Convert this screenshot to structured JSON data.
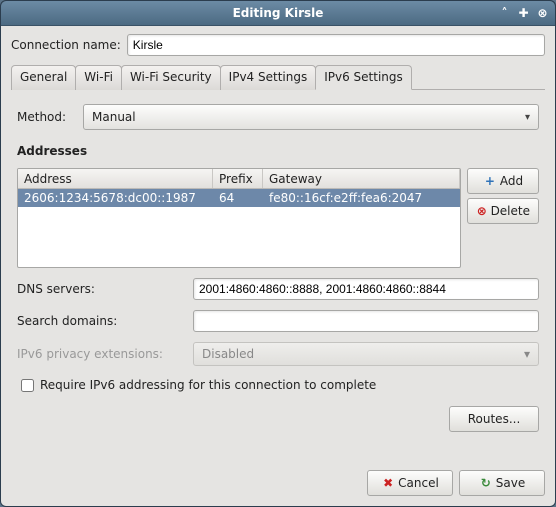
{
  "window": {
    "title": "Editing Kirsle"
  },
  "connection": {
    "label": "Connection name:",
    "value": "Kirsle"
  },
  "tabs": {
    "general": "General",
    "wifi": "Wi-Fi",
    "wifisec": "Wi-Fi Security",
    "ipv4": "IPv4 Settings",
    "ipv6": "IPv6 Settings",
    "active": "ipv6"
  },
  "method": {
    "label": "Method:",
    "value": "Manual"
  },
  "addresses": {
    "title": "Addresses",
    "columns": {
      "address": "Address",
      "prefix": "Prefix",
      "gateway": "Gateway"
    },
    "rows": [
      {
        "address": "2606:1234:5678:dc00::1987",
        "prefix": "64",
        "gateway": "fe80::16cf:e2ff:fea6:2047"
      }
    ],
    "add": "Add",
    "delete": "Delete"
  },
  "dns": {
    "label": "DNS servers:",
    "value": "2001:4860:4860::8888, 2001:4860:4860::8844"
  },
  "search": {
    "label": "Search domains:",
    "value": ""
  },
  "privacy": {
    "label": "IPv6 privacy extensions:",
    "value": "Disabled"
  },
  "require": {
    "label": "Require IPv6 addressing for this connection to complete",
    "checked": false
  },
  "routes": {
    "label": "Routes..."
  },
  "footer": {
    "cancel": "Cancel",
    "save": "Save"
  }
}
